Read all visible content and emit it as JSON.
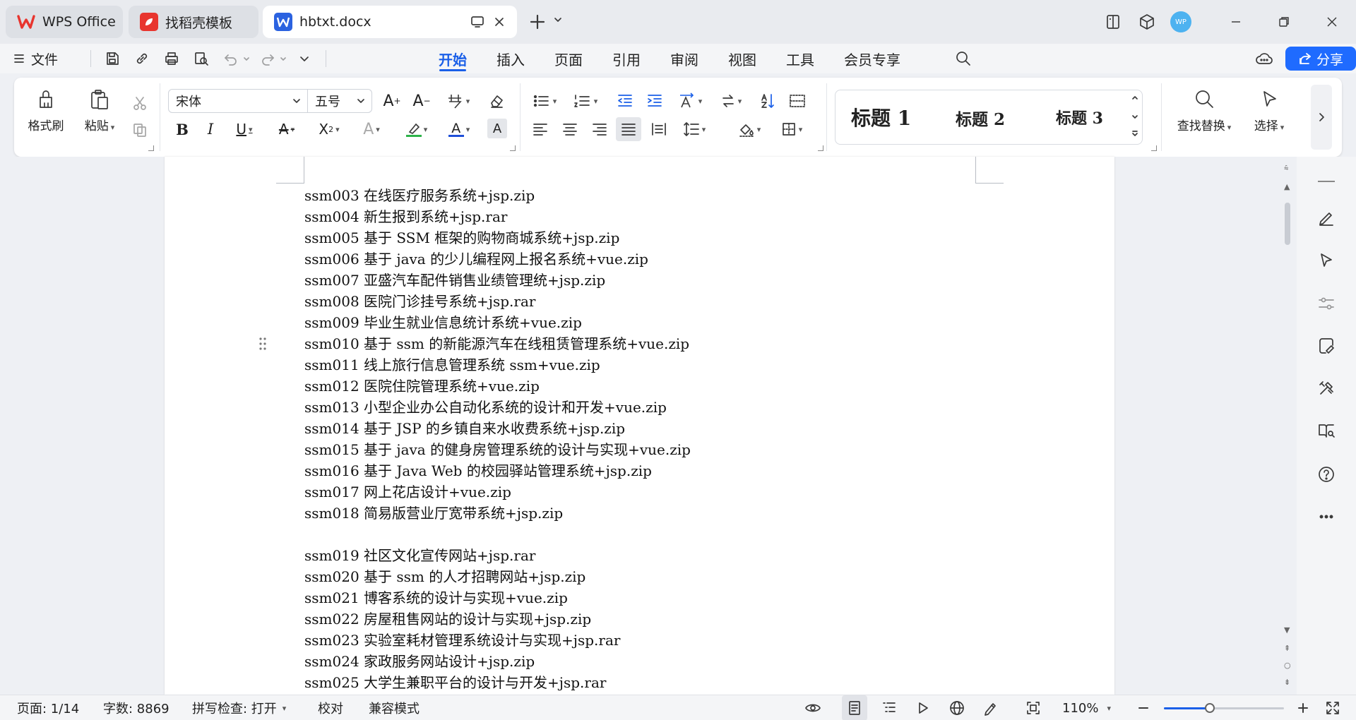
{
  "titlebar": {
    "tabs": [
      {
        "label": "WPS Office",
        "active": false
      },
      {
        "label": "找稻壳模板",
        "active": false
      },
      {
        "label": "hbtxt.docx",
        "active": true
      }
    ],
    "avatar_text": "WP"
  },
  "menubar": {
    "file_label": "文件",
    "tabs": [
      "开始",
      "插入",
      "页面",
      "引用",
      "审阅",
      "视图",
      "工具",
      "会员专享"
    ],
    "active_tab": "开始",
    "share_label": "分享"
  },
  "ribbon": {
    "format_painter": "格式刷",
    "paste": "粘贴",
    "font_name": "宋体",
    "font_size": "五号",
    "styles": [
      "标题 1",
      "标题 2",
      "标题 3"
    ],
    "find_replace": "查找替换",
    "select": "选择"
  },
  "document": {
    "lines": [
      "ssm003 在线医疗服务系统+jsp.zip",
      "ssm004 新生报到系统+jsp.rar",
      "ssm005 基于 SSM 框架的购物商城系统+jsp.zip",
      "ssm006 基于 java 的少儿编程网上报名系统+vue.zip",
      "ssm007 亚盛汽车配件销售业绩管理统+jsp.zip",
      "ssm008 医院门诊挂号系统+jsp.rar",
      "ssm009 毕业生就业信息统计系统+vue.zip",
      "ssm010 基于 ssm 的新能源汽车在线租赁管理系统+vue.zip",
      "ssm011 线上旅行信息管理系统 ssm+vue.zip",
      "ssm012 医院住院管理系统+vue.zip",
      "ssm013 小型企业办公自动化系统的设计和开发+vue.zip",
      "ssm014 基于 JSP 的乡镇自来水收费系统+jsp.zip",
      "ssm015 基于 java 的健身房管理系统的设计与实现+vue.zip",
      "ssm016 基于 Java Web 的校园驿站管理系统+jsp.zip",
      "ssm017 网上花店设计+vue.zip",
      "ssm018 简易版营业厅宽带系统+jsp.zip",
      "",
      "ssm019 社区文化宣传网站+jsp.rar",
      "ssm020 基于 ssm 的人才招聘网站+jsp.zip",
      "ssm021 博客系统的设计与实现+vue.zip",
      "ssm022 房屋租售网站的设计与实现+jsp.zip",
      "ssm023 实验室耗材管理系统设计与实现+jsp.rar",
      "ssm024 家政服务网站设计+jsp.zip",
      "ssm025 大学生兼职平台的设计与开发+jsp.rar"
    ]
  },
  "statusbar": {
    "page": "页面: 1/14",
    "word_count": "字数: 8869",
    "spell_check": "拼写检查: 打开",
    "proofread": "校对",
    "compat_mode": "兼容模式",
    "zoom": "110%",
    "zoom_level": 0.38
  },
  "colors": {
    "accent": "#1a5fe8",
    "share_bg": "#1f6bff",
    "wps_red": "#e8352e"
  }
}
